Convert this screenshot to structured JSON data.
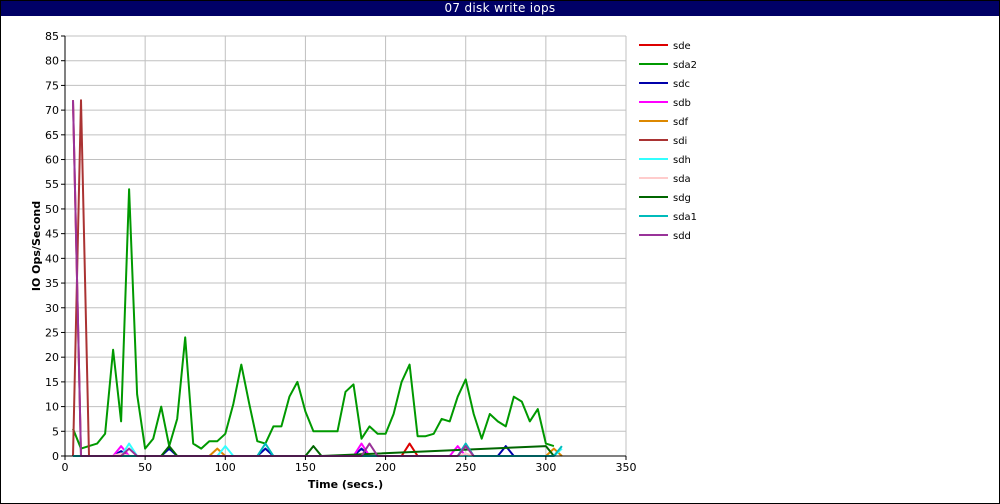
{
  "window": {
    "title": "07 disk write iops"
  },
  "chart_data": {
    "type": "line",
    "title": "07 disk write iops",
    "xlabel": "Time (secs.)",
    "ylabel": "IO Ops/Second",
    "xlim": [
      0,
      350
    ],
    "ylim": [
      0,
      85
    ],
    "xticks": [
      0,
      50,
      100,
      150,
      200,
      250,
      300,
      350
    ],
    "yticks": [
      0,
      5,
      10,
      15,
      20,
      25,
      30,
      35,
      40,
      45,
      50,
      55,
      60,
      65,
      70,
      75,
      80,
      85
    ],
    "grid": true,
    "legend_position": "right",
    "series": [
      {
        "name": "sde",
        "color": "#dd0000",
        "x": [
          5,
          10,
          15,
          35,
          40,
          65,
          70,
          120,
          125,
          155,
          160,
          185,
          190,
          210,
          215,
          220,
          245,
          250,
          270,
          275,
          280
        ],
        "y": [
          72,
          0,
          0,
          0,
          0,
          0,
          0,
          0,
          0,
          0,
          0,
          0,
          0,
          0,
          2.5,
          0,
          0,
          0,
          0,
          0,
          0
        ]
      },
      {
        "name": "sda2",
        "color": "#009900",
        "x": [
          5,
          10,
          15,
          20,
          25,
          30,
          35,
          40,
          45,
          50,
          55,
          60,
          65,
          70,
          75,
          80,
          85,
          90,
          95,
          100,
          105,
          110,
          115,
          120,
          125,
          130,
          135,
          140,
          145,
          150,
          155,
          160,
          165,
          170,
          175,
          180,
          185,
          190,
          195,
          200,
          205,
          210,
          215,
          220,
          225,
          230,
          235,
          240,
          245,
          250,
          255,
          260,
          265,
          270,
          275,
          280,
          285,
          290,
          295,
          300,
          305
        ],
        "y": [
          5.5,
          1.5,
          2,
          2.5,
          4.5,
          21.5,
          7,
          54,
          12.5,
          1.5,
          3.5,
          10,
          2,
          7.5,
          24,
          2.5,
          1.5,
          3,
          3,
          4.5,
          10.5,
          18.5,
          10.5,
          3,
          2.5,
          6,
          6,
          12,
          15,
          9,
          5,
          5,
          5,
          5,
          13,
          14.5,
          3.5,
          6,
          4.5,
          4.5,
          8.5,
          15,
          18.5,
          4,
          4,
          4.5,
          7.5,
          7,
          12,
          15.5,
          8.5,
          3.5,
          8.5,
          7,
          6,
          12,
          11,
          7,
          9.5,
          2.5,
          2
        ]
      },
      {
        "name": "sdc",
        "color": "#0000aa",
        "x": [
          5,
          30,
          35,
          40,
          60,
          65,
          70,
          120,
          125,
          130,
          180,
          185,
          190,
          270,
          275,
          280,
          305
        ],
        "y": [
          0,
          0,
          1,
          0,
          0,
          1.5,
          0,
          0,
          1.5,
          0,
          0,
          1.5,
          0,
          0,
          2,
          0,
          0
        ]
      },
      {
        "name": "sdb",
        "color": "#ff00ff",
        "x": [
          5,
          30,
          35,
          40,
          180,
          185,
          190,
          240,
          245,
          250,
          305
        ],
        "y": [
          0,
          0,
          2,
          0,
          0,
          2.5,
          0,
          0,
          2,
          0,
          0
        ]
      },
      {
        "name": "sdf",
        "color": "#dd8800",
        "x": [
          5,
          90,
          95,
          100,
          300,
          305,
          310
        ],
        "y": [
          0,
          0,
          1.5,
          0,
          0,
          1.5,
          0
        ]
      },
      {
        "name": "sdi",
        "color": "#aa3333",
        "x": [
          5,
          10,
          15,
          40,
          45,
          50,
          190,
          195,
          200
        ],
        "y": [
          0,
          72,
          0,
          0,
          0,
          0,
          0,
          0,
          0
        ]
      },
      {
        "name": "sdh",
        "color": "#33ffff",
        "x": [
          5,
          35,
          40,
          45,
          95,
          100,
          105,
          305,
          310
        ],
        "y": [
          0,
          0,
          2.5,
          0,
          0,
          2,
          0,
          0,
          1.5
        ]
      },
      {
        "name": "sda",
        "color": "#ffcccc",
        "x": [
          5,
          30,
          35,
          40,
          180,
          185,
          190,
          245,
          250,
          255
        ],
        "y": [
          0,
          0,
          0.5,
          0,
          0,
          0.5,
          0,
          0,
          0.5,
          0
        ]
      },
      {
        "name": "sdg",
        "color": "#006600",
        "x": [
          5,
          60,
          65,
          70,
          150,
          155,
          160,
          300,
          305
        ],
        "y": [
          0,
          0,
          2,
          0,
          0,
          2,
          0,
          2,
          0
        ]
      },
      {
        "name": "sda1",
        "color": "#00bbbb",
        "x": [
          5,
          120,
          125,
          130,
          245,
          250,
          255,
          305,
          310
        ],
        "y": [
          0,
          0,
          2.5,
          0,
          0,
          2.5,
          0,
          0,
          2
        ]
      },
      {
        "name": "sdd",
        "color": "#993399",
        "x": [
          5,
          10,
          15,
          35,
          40,
          45,
          185,
          190,
          195,
          245,
          250,
          255
        ],
        "y": [
          72,
          0,
          0,
          0,
          1.5,
          0,
          0,
          2.5,
          0,
          0,
          2,
          0
        ]
      }
    ]
  }
}
